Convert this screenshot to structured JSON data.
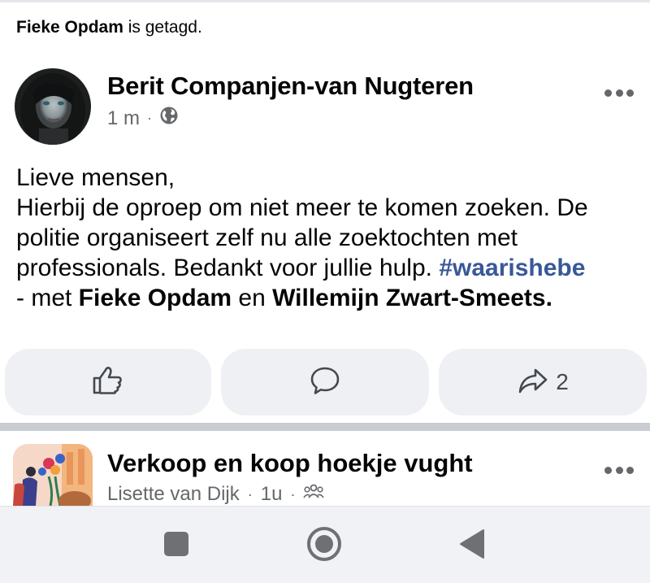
{
  "tag_line": {
    "name": "Fieke Opdam",
    "suffix": " is getagd."
  },
  "post": {
    "author": "Berit Companjen-van Nugteren",
    "time": "1 m",
    "audience_icon": "globe-icon",
    "text": {
      "line1": "Lieve mensen,",
      "line2": "Hierbij de oproep om niet meer te komen zoeken. De",
      "line3": "politie organiseert zelf nu alle zoektochten met",
      "line4_start": "professionals. Bedankt voor jullie hulp. ",
      "hashtag": "#waarishebe",
      "line5_prefix": "- met ",
      "tag1": "Fieke Opdam",
      "and": " en ",
      "tag2": "Willemijn Zwart-Smeets."
    },
    "actions": {
      "like_icon": "thumbs-up-icon",
      "comment_icon": "comment-icon",
      "share_icon": "share-icon",
      "share_count": "2"
    }
  },
  "next_post": {
    "group_name": "Verkoop en koop hoekje vught",
    "poster": "Lisette van Dijk",
    "time": "1u",
    "audience_icon": "group-icon"
  },
  "navbar": {
    "recents_icon": "square-icon",
    "home_icon": "circle-icon",
    "back_icon": "triangle-back-icon"
  },
  "colors": {
    "hashtag": "#385898",
    "secondary_text": "#65676b",
    "button_bg": "#eef0f3",
    "separator": "#c9ccd1"
  }
}
